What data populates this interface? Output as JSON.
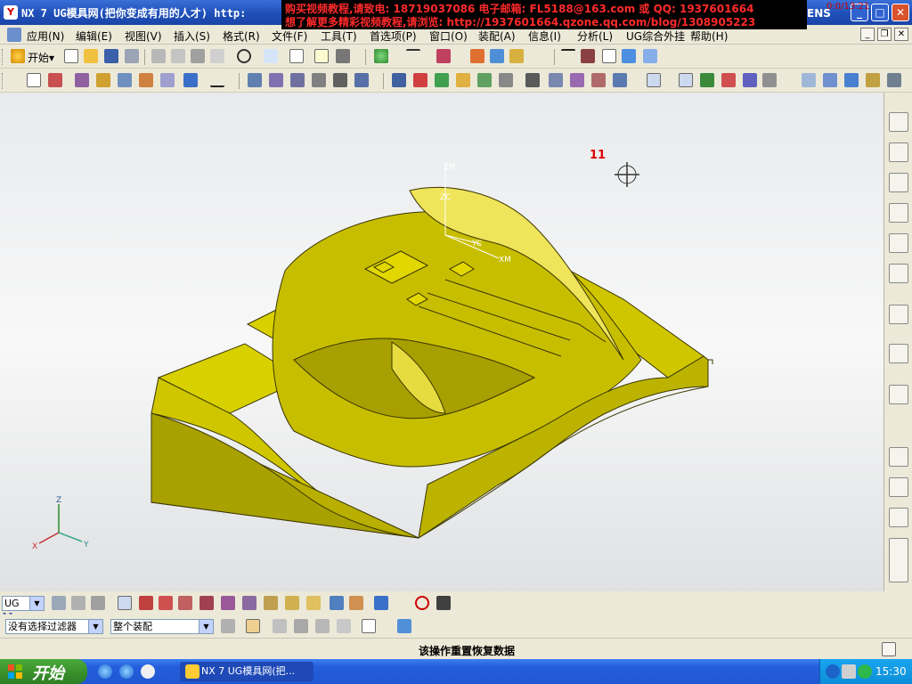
{
  "title_bar": {
    "title": "NX 7 UG模具网(把你变成有用的人才) http:",
    "banner_line1": "购买视频教程,请致电: 18719037086 电子邮箱: FL5188@163.com 或 QQ: 1937601664",
    "banner_line2": "想了解更多精彩视频教程,请浏览: http://1937601664.qzone.qq.com/blog/1308905223",
    "brand": "ENS",
    "corner_text": "0:0/13:21",
    "minimize": "_",
    "maximize": "□",
    "close": "✕"
  },
  "menu": {
    "items": [
      "应用(N)",
      "编辑(E)",
      "视图(V)",
      "插入(S)",
      "格式(R)",
      "文件(F)",
      "工具(T)",
      "首选项(P)",
      "窗口(O)",
      "装配(A)",
      "信息(I)",
      "分析(L)",
      "UG综合外挂",
      "帮助(H)"
    ],
    "mdi_min": "_",
    "mdi_restore": "❐",
    "mdi_close": "✕"
  },
  "toolbar1": {
    "start_label": "开始▾"
  },
  "viewport": {
    "annotation_label": "11",
    "wcs_labels": {
      "zm": "ZM",
      "zc": "ZC",
      "yc": "YC",
      "xm": "XM"
    },
    "triad_labels": {
      "z": "Z",
      "x": "X",
      "y": "Y"
    }
  },
  "bottom_toolbar": {
    "selector_value": "UG",
    "label_11": "11",
    "filter_value": "没有选择过滤器",
    "scope_value": "整个装配"
  },
  "status": {
    "text": "该操作重置恢复数据"
  },
  "taskbar": {
    "start_label": "开始",
    "task_label": "NX 7 UG模具网(把...",
    "clock": "15:30"
  },
  "colors": {
    "part_top": "#d9d000",
    "part_side": "#b3ab00",
    "annotation": "#e00000",
    "viewport_bg": "#f0f1f2"
  }
}
